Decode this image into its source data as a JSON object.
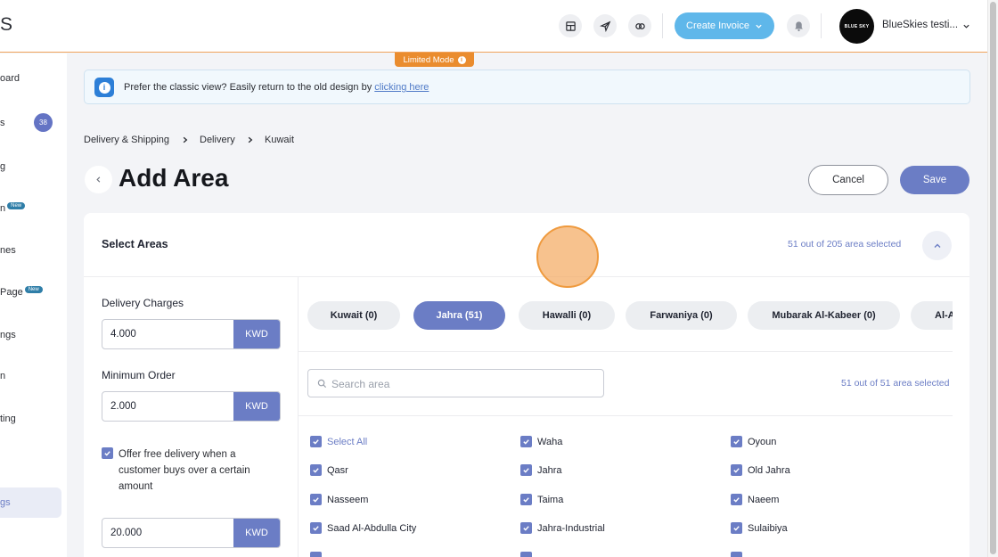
{
  "app": {
    "brand_fragment": "S"
  },
  "header": {
    "create_invoice_label": "Create Invoice",
    "avatar_text": "BLUE SKY",
    "account_name": "BlueSkies testi..."
  },
  "sidebar": {
    "items": [
      {
        "label": "oard"
      },
      {
        "label": "s",
        "badge": "38"
      },
      {
        "label": "g"
      },
      {
        "label": "n",
        "new": "New"
      },
      {
        "label": "nes"
      },
      {
        "label": "Page",
        "new": "New"
      },
      {
        "label": "ngs"
      },
      {
        "label": "n"
      },
      {
        "label": "ting"
      },
      {
        "label": "gs"
      }
    ]
  },
  "limited_mode": {
    "label": "Limited Mode"
  },
  "banner": {
    "text": "Prefer the classic view? Easily return to the old design by",
    "link": "clicking here"
  },
  "breadcrumb": [
    "Delivery & Shipping",
    "Delivery",
    "Kuwait"
  ],
  "page": {
    "title": "Add Area",
    "cancel_label": "Cancel",
    "save_label": "Save"
  },
  "select_areas": {
    "title": "Select Areas",
    "selected_summary": "51 out of 205 area selected"
  },
  "delivery": {
    "charges_label": "Delivery Charges",
    "charges_value": "4.000",
    "min_order_label": "Minimum Order",
    "min_order_value": "2.000",
    "currency": "KWD",
    "free_delivery_text": "Offer free delivery when a customer buys over a certain amount",
    "free_delivery_checked": true,
    "free_delivery_value": "20.000"
  },
  "governorate_tabs": [
    {
      "label": "Kuwait (0)",
      "active": false
    },
    {
      "label": "Jahra (51)",
      "active": true
    },
    {
      "label": "Hawalli (0)",
      "active": false
    },
    {
      "label": "Farwaniya (0)",
      "active": false
    },
    {
      "label": "Mubarak Al-Kabeer (0)",
      "active": false
    },
    {
      "label": "Al-A",
      "active": false
    }
  ],
  "search": {
    "placeholder": "Search area"
  },
  "list_summary": "51 out of 51 area selected",
  "areas": [
    {
      "label": "Select All",
      "checked": true
    },
    {
      "label": "Waha",
      "checked": true
    },
    {
      "label": "Oyoun",
      "checked": true
    },
    {
      "label": "Qasr",
      "checked": true
    },
    {
      "label": "Jahra",
      "checked": true
    },
    {
      "label": "Old Jahra",
      "checked": true
    },
    {
      "label": "Nasseem",
      "checked": true
    },
    {
      "label": "Taima",
      "checked": true
    },
    {
      "label": "Naeem",
      "checked": true
    },
    {
      "label": "Saad Al-Abdulla City",
      "checked": true
    },
    {
      "label": "Jahra-Industrial",
      "checked": true
    },
    {
      "label": "Sulaibiya",
      "checked": true
    }
  ],
  "colors": {
    "accent": "#6b7dc5",
    "create_invoice": "#5fb7ea",
    "limited_mode": "#ea8c2e",
    "banner_icon": "#2d7fd7"
  }
}
